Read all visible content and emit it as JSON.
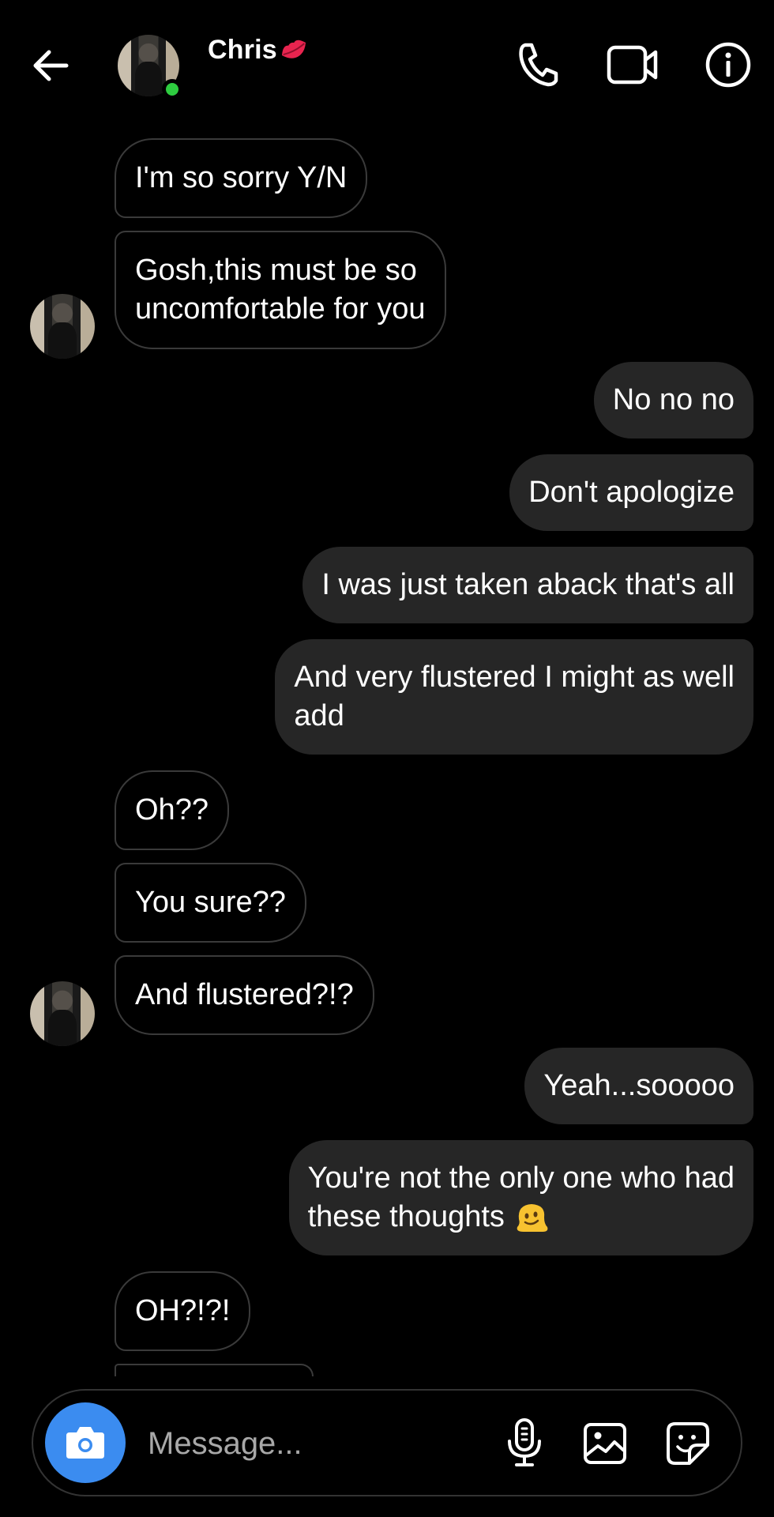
{
  "header": {
    "contact_name": "Chris",
    "name_emoji": "lips-kiss-mark-icon",
    "online_status_color": "#2ecc40",
    "icons": [
      "back-arrow-icon",
      "phone-icon",
      "video-camera-icon",
      "info-icon"
    ]
  },
  "messages": [
    {
      "from": "Chris",
      "text": "I'm so sorry Y/N"
    },
    {
      "from": "Chris",
      "text_lines": [
        "Gosh,this must be so",
        "uncomfortable for you"
      ]
    },
    {
      "from": "me",
      "text": "No no no"
    },
    {
      "from": "me",
      "text": "Don't apologize"
    },
    {
      "from": "me",
      "text": "I was just taken aback that's all"
    },
    {
      "from": "me",
      "text_lines": [
        "And very flustered I might as well",
        "add"
      ]
    },
    {
      "from": "Chris",
      "text": "Oh??"
    },
    {
      "from": "Chris",
      "text": "You sure??"
    },
    {
      "from": "Chris",
      "text": "And flustered?!?"
    },
    {
      "from": "me",
      "text": "Yeah...sooooo"
    },
    {
      "from": "me",
      "text_lines": [
        "You're not the only one who had",
        "these thoughts"
      ],
      "emoji": "melting-face-icon"
    },
    {
      "from": "Chris",
      "text": "OH?!?!"
    }
  ],
  "composer": {
    "placeholder": "Message...",
    "camera_button_color": "#3b8cf0",
    "icons": [
      "camera-icon",
      "microphone-icon",
      "gallery-icon",
      "sticker-icon"
    ]
  },
  "colors": {
    "background": "#000000",
    "outgoing_bubble": "#262626",
    "incoming_border": "#3a3a3a"
  }
}
